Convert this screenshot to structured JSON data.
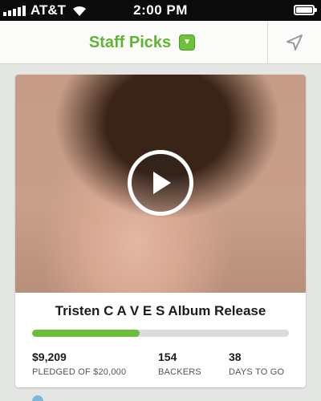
{
  "status_bar": {
    "carrier": "AT&T",
    "time": "2:00 PM",
    "icons": [
      "signal-icon",
      "wifi-icon",
      "battery-icon"
    ]
  },
  "nav": {
    "title": "Staff Picks",
    "dropdown_icon": "chevron-down-icon",
    "location_icon": "location-arrow-icon",
    "accent_color": "#5fb531"
  },
  "project": {
    "title": "Tristen C A V E S Album Release",
    "funded_fraction": 0.42,
    "progress_color": "#6cbd3a",
    "stats": [
      {
        "value": "$9,209",
        "label": "PLEDGED OF $20,000"
      },
      {
        "value": "154",
        "label": "BACKERS"
      },
      {
        "value": "38",
        "label": "DAYS TO GO"
      }
    ]
  }
}
